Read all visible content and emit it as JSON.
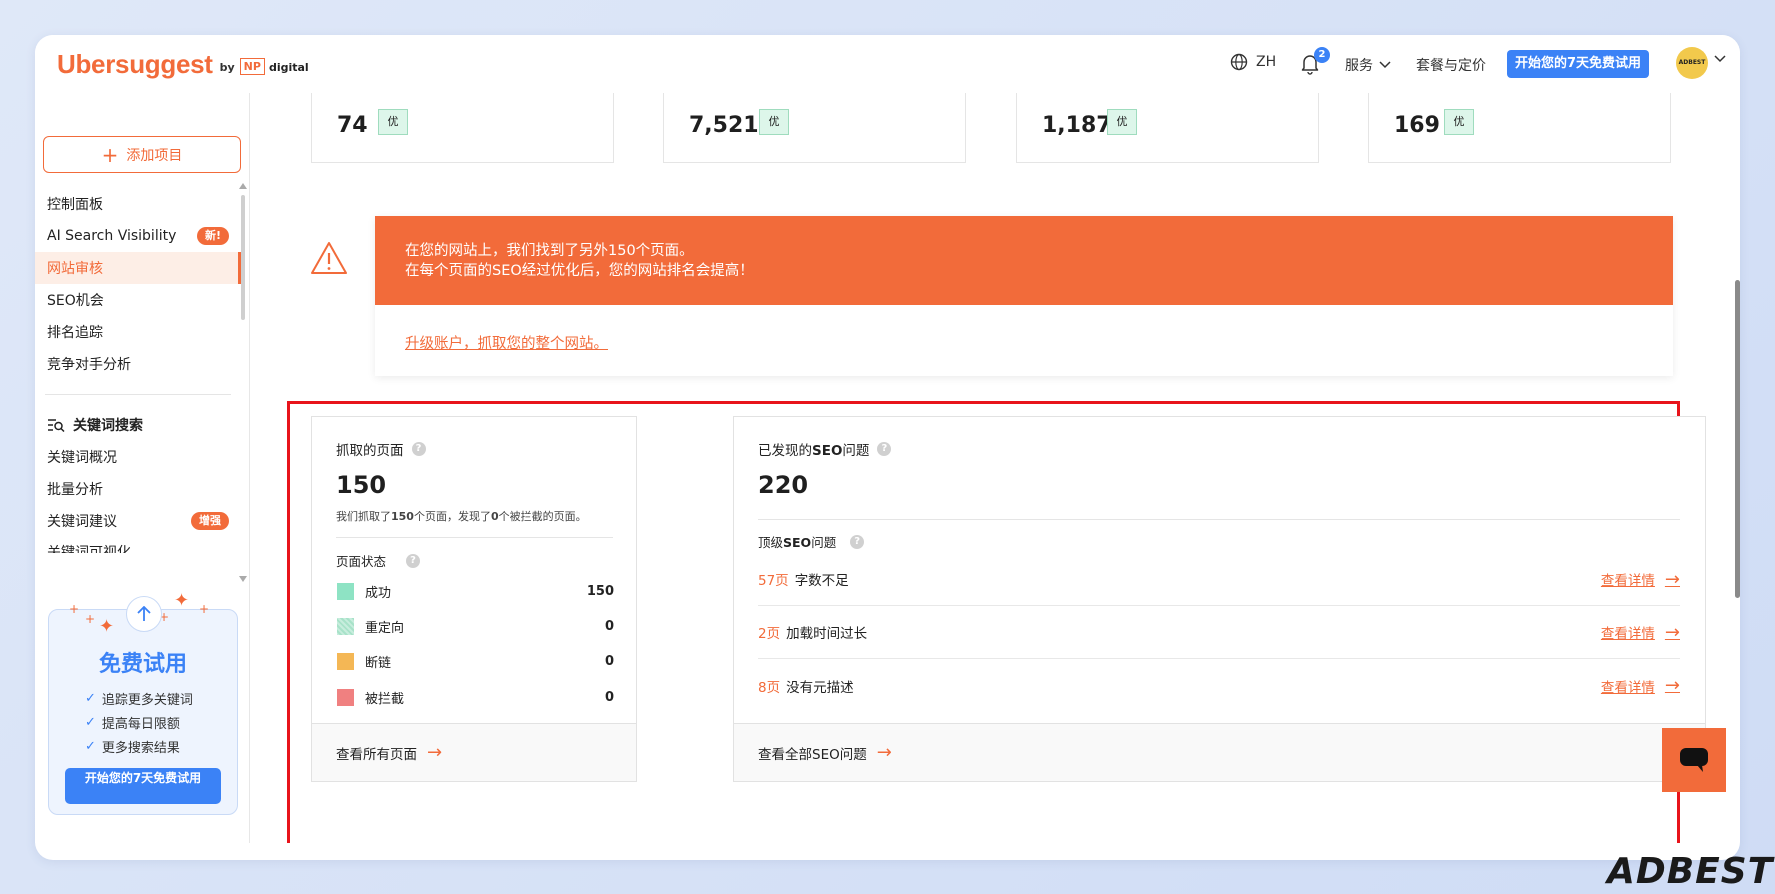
{
  "header": {
    "logo_word": "Ubersuggest",
    "logo_by": "by",
    "logo_np": "NP",
    "logo_digital": "digital",
    "language": "ZH",
    "notification_count": "2",
    "services": "服务",
    "pricing": "套餐与定价",
    "trial_button": "开始您的7天免费试用",
    "avatar_text": "ADBEST"
  },
  "sidebar": {
    "add_project": "添加项目",
    "items": [
      {
        "label": "控制面板"
      },
      {
        "label": "AI Search Visibility",
        "badge": "新!"
      },
      {
        "label": "网站审核",
        "active": true
      },
      {
        "label": "SEO机会"
      },
      {
        "label": "排名追踪"
      },
      {
        "label": "竞争对手分析"
      }
    ],
    "section_keyword": "关键词搜索",
    "keyword_items": [
      {
        "label": "关键词概况"
      },
      {
        "label": "批量分析"
      },
      {
        "label": "关键词建议",
        "badge": "增强"
      },
      {
        "label": "关键词可视化"
      }
    ],
    "trial_card": {
      "title": "免费试用",
      "features": [
        "追踪更多关键词",
        "提高每日限额",
        "更多搜索结果"
      ],
      "button": "开始您的7天免费试用"
    }
  },
  "stats": [
    {
      "value": "74",
      "tag": "优"
    },
    {
      "value": "7,521",
      "tag": "优"
    },
    {
      "value": "1,187",
      "tag": "优"
    },
    {
      "value": "169",
      "tag": "优"
    }
  ],
  "alert": {
    "line1": "在您的网站上，我们找到了另外150个页面。",
    "line2": "在每个页面的SEO经过优化后，您的网站排名会提高！",
    "link": "升级账户，抓取您的整个网站。"
  },
  "crawled": {
    "title": "抓取的页面",
    "value": "150",
    "desc_pre": "我们抓取了",
    "desc_n1": "150",
    "desc_mid": "个页面，发现了",
    "desc_n2": "0",
    "desc_post": "个被拦截的页面。",
    "status_title": "页面状态",
    "statuses": [
      {
        "label": "成功",
        "value": "150",
        "color": "#8ee3c4"
      },
      {
        "label": "重定向",
        "value": "0",
        "color": "#c7eddd"
      },
      {
        "label": "断链",
        "value": "0",
        "color": "#f4b755"
      },
      {
        "label": "被拦截",
        "value": "0",
        "color": "#f08080"
      }
    ],
    "footer": "查看所有页面"
  },
  "issues": {
    "title_pre": "已发现的",
    "title_bold": "SEO",
    "title_post": "问题",
    "value": "220",
    "top_pre": "顶级",
    "top_bold": "SEO",
    "top_post": "问题",
    "rows": [
      {
        "count": "57页",
        "label": "字数不足",
        "link": "查看详情"
      },
      {
        "count": "2页",
        "label": "加载时间过长",
        "link": "查看详情"
      },
      {
        "count": "8页",
        "label": "没有元描述",
        "link": "查看详情"
      }
    ],
    "footer": "查看全部SEO问题"
  },
  "watermark": "ADBEST",
  "colors": {
    "accent": "#f26b3a",
    "primary": "#3b82f6",
    "highlight_box": "#e8141b"
  }
}
